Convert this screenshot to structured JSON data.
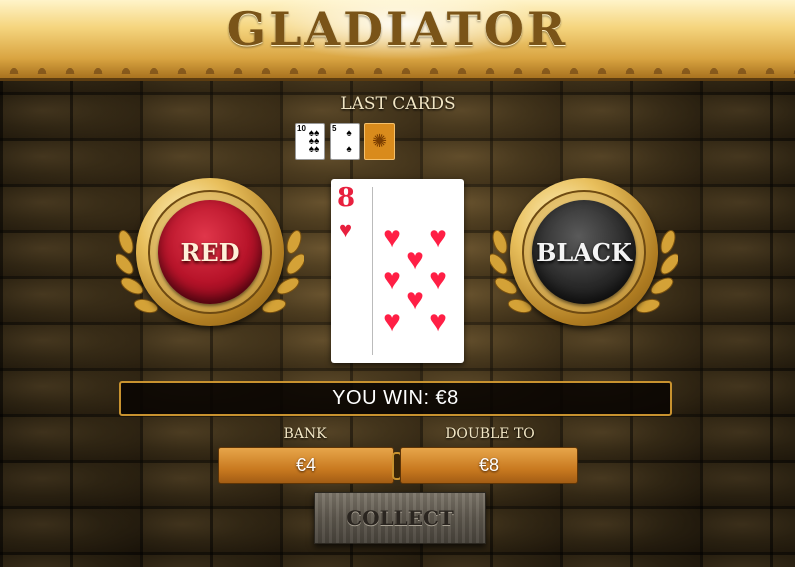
{
  "game": {
    "title": "GLADIATOR"
  },
  "last_cards": {
    "label": "LAST CARDS",
    "cards": [
      {
        "rank": "10",
        "suit": "♠"
      },
      {
        "rank": "5",
        "suit": "♠"
      },
      {
        "face_down": true,
        "icon": "compass-back-icon"
      }
    ]
  },
  "buttons": {
    "red": "RED",
    "black": "BLACK",
    "collect": "COLLECT"
  },
  "current_card": {
    "rank": "8",
    "suit": "♥",
    "suit_name": "hearts",
    "color": "#ff1f45"
  },
  "win": {
    "text": "YOU WIN: €8"
  },
  "bank": {
    "label": "BANK",
    "value": "€4"
  },
  "double_to": {
    "label": "DOUBLE TO",
    "value": "€8"
  }
}
